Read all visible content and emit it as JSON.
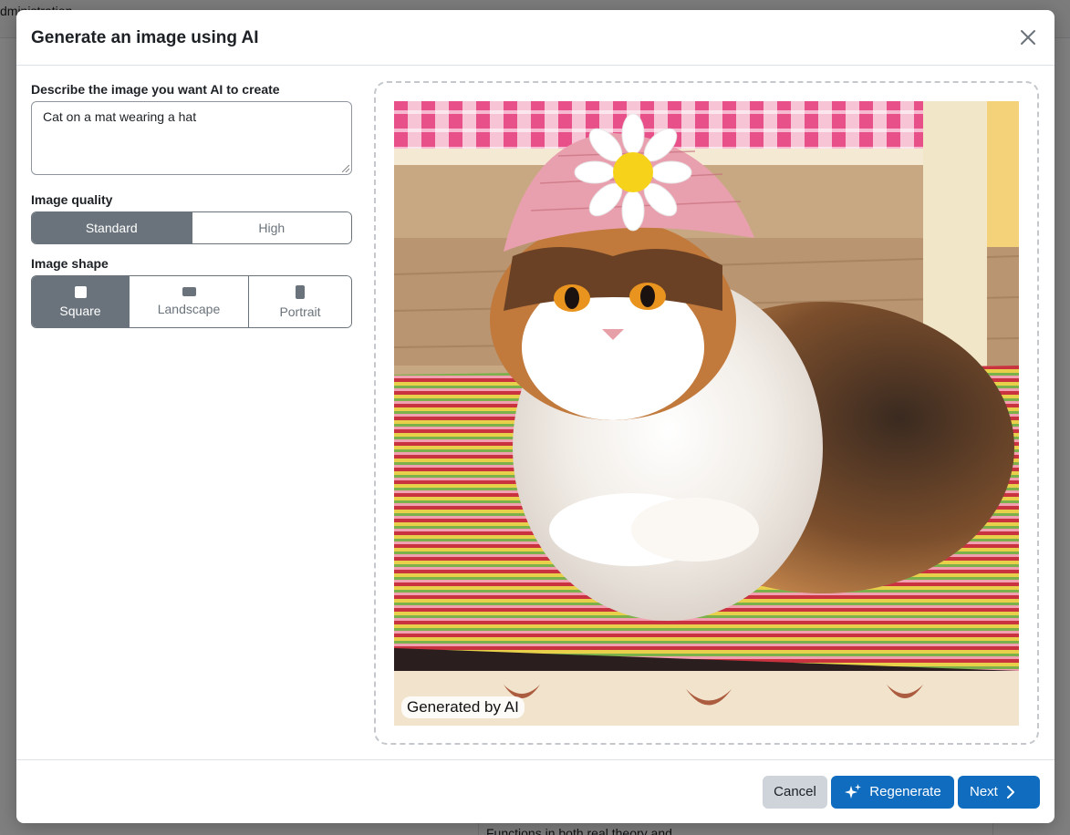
{
  "background": {
    "breadcrumb": "dministration",
    "snippet": "Functions in both real theory and..."
  },
  "modal": {
    "title": "Generate an image using AI",
    "close_label": "×"
  },
  "form": {
    "prompt_label": "Describe the image you want AI to create",
    "prompt_value": "Cat on a mat wearing a hat",
    "quality_label": "Image quality",
    "quality_options": [
      "Standard",
      "High"
    ],
    "quality_selected": "Standard",
    "shape_label": "Image shape",
    "shape_options": [
      "Square",
      "Landscape",
      "Portrait"
    ],
    "shape_selected": "Square"
  },
  "preview": {
    "badge": "Generated by AI"
  },
  "footer": {
    "cancel_label": "Cancel",
    "regenerate_label": "Regenerate",
    "next_label": "Next"
  },
  "colors": {
    "primary": "#0f6cbf",
    "segment_active": "#6a737b",
    "cancel_bg": "#ced4da"
  }
}
